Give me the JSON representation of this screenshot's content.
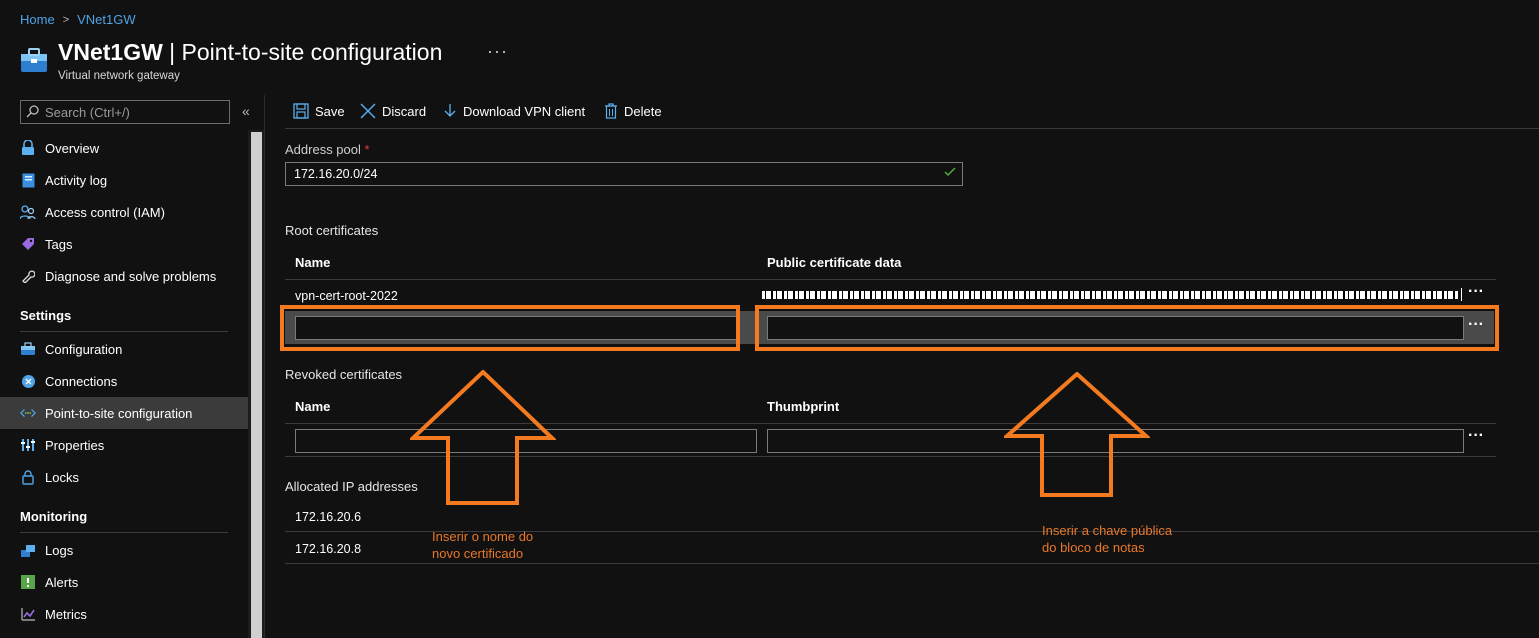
{
  "breadcrumb": {
    "home": "Home",
    "current": "VNet1GW"
  },
  "header": {
    "title_bold": "VNet1GW",
    "title_rest": " | Point-to-site configuration",
    "more": "···",
    "subtitle": "Virtual network gateway"
  },
  "search": {
    "placeholder": "Search (Ctrl+/)",
    "collapse": "«"
  },
  "sidebar": {
    "items_top": [
      {
        "label": "Overview",
        "icon": "overview-icon"
      },
      {
        "label": "Activity log",
        "icon": "activity-log-icon"
      },
      {
        "label": "Access control (IAM)",
        "icon": "iam-icon"
      },
      {
        "label": "Tags",
        "icon": "tag-icon"
      },
      {
        "label": "Diagnose and solve problems",
        "icon": "wrench-icon"
      }
    ],
    "settings_label": "Settings",
    "settings_items": [
      {
        "label": "Configuration",
        "icon": "toolbox-icon"
      },
      {
        "label": "Connections",
        "icon": "connections-icon"
      },
      {
        "label": "Point-to-site configuration",
        "icon": "point-to-site-icon",
        "active": true
      },
      {
        "label": "Properties",
        "icon": "properties-icon"
      },
      {
        "label": "Locks",
        "icon": "lock-icon"
      }
    ],
    "monitoring_label": "Monitoring",
    "monitoring_items": [
      {
        "label": "Logs",
        "icon": "logs-icon"
      },
      {
        "label": "Alerts",
        "icon": "alert-icon"
      },
      {
        "label": "Metrics",
        "icon": "metrics-icon"
      }
    ]
  },
  "toolbar": {
    "save": "Save",
    "discard": "Discard",
    "download": "Download VPN client",
    "delete": "Delete"
  },
  "address_pool": {
    "label": "Address pool",
    "required": "*",
    "value": "172.16.20.0/24"
  },
  "root_certs": {
    "title": "Root certificates",
    "col_name": "Name",
    "col_data": "Public certificate data",
    "rows": [
      {
        "name": "vpn-cert-root-2022"
      }
    ],
    "more": "···"
  },
  "revoked": {
    "title": "Revoked certificates",
    "col_name": "Name",
    "col_thumb": "Thumbprint",
    "more": "···"
  },
  "allocated": {
    "title": "Allocated IP addresses",
    "ips": [
      "172.16.20.6",
      "172.16.20.8"
    ]
  },
  "annotations": {
    "left_line1": "Inserir o nome do",
    "left_line2": "novo certificado",
    "right_line1": "Inserir a chave pública",
    "right_line2": "do bloco de notas"
  },
  "colors": {
    "accent": "#4fa3e6",
    "annotation": "#f47a20",
    "background": "#111111"
  }
}
